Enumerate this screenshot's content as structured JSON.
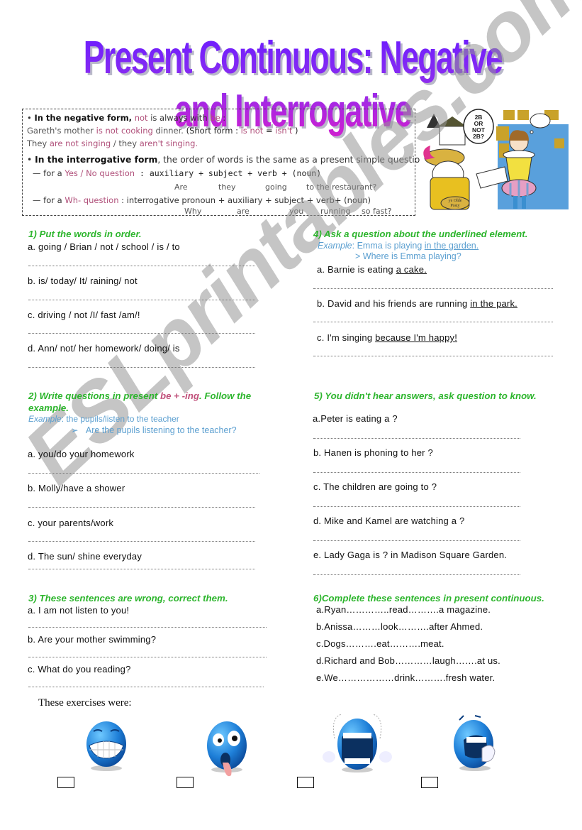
{
  "title": "Present Continuous: Negative and Interrogative",
  "grammar": {
    "negative_heading": "In the negative form,",
    "negative_rule_not": "not",
    "negative_rule_mid": " is always with ",
    "negative_rule_be": "be",
    "negative_rule_end": " :",
    "example1_a": "Gareth's mother ",
    "example1_b": "is not cooking",
    "example1_c": " dinner. ",
    "example1_d": "(Short form : ",
    "example1_e": "is not",
    "example1_f": " = ",
    "example1_g": "isn't",
    "example1_h": " )",
    "example2_a": "They ",
    "example2_b": "are not singing",
    "example2_c": " / they ",
    "example2_d": "aren't singing.",
    "interrogative_heading": "In the interrogative form",
    "interrogative_rule": ", the order of words is the same as a present simple question.",
    "yesno_prefix": "— for a ",
    "yesno_label": "Yes / No question",
    "yesno_formula": " : auxiliary + subject + verb + (noun)",
    "yesno_example": [
      "Are",
      "they",
      "going",
      "to the restaurant?"
    ],
    "wh_prefix": "— for a ",
    "wh_label": "Wh- question",
    "wh_formula": " : interrogative pronoun + auxiliary + subject + verb+  (noun)",
    "wh_example": [
      "Why",
      "are",
      "you",
      "running",
      "so fast?"
    ]
  },
  "illustration": {
    "speech_bubble": [
      "2B",
      "OR",
      "NOT",
      "2B?"
    ],
    "bag_label": [
      "ye Olde",
      "Posty"
    ]
  },
  "section1": {
    "title": "1) Put the words in order.",
    "items": [
      "a. going / Brian / not / school / is / to",
      "b. is/ today/ It/ raining/ not",
      "c. driving / not /I/ fast /am/!",
      "d. Ann/ not/ her homework/ doing/ is"
    ]
  },
  "section2": {
    "title_a": "2) Write questions in present ",
    "title_b": "be + -ing",
    "title_c": ". Follow the",
    "title_d": "example.",
    "example_label": "Example",
    "example_prompt": ": the pupils/listen to the teacher",
    "example_answer": "Are the pupils listening to the teacher?",
    "items": [
      "a. you/do your homework",
      "b. Molly/have a shower",
      "c. your parents/work",
      "d. The sun/ shine everyday"
    ]
  },
  "section3": {
    "title": "3) These sentences are wrong, correct them.",
    "items": [
      "a. I am not listen to you!",
      "b. Are your  mother swimming?",
      "c. What do you reading?"
    ]
  },
  "section4": {
    "title": "4) Ask a question about the underlined element.",
    "example_label": "Example",
    "example_a": ": Emma is playing ",
    "example_b": "in the garden.",
    "example_answer": "> Where is Emma playing?",
    "items": [
      {
        "plain": "a. Barnie is eating ",
        "underlined": "a cake."
      },
      {
        "plain": "b. David and his friends are running ",
        "underlined": "in the park."
      },
      {
        "plain": "c. I'm singing ",
        "underlined": "because I'm happy!"
      }
    ]
  },
  "section5": {
    "title": "5) You didn't hear answers, ask question to know.",
    "items": [
      "a.Peter is eating a ?",
      "b. Hanen is phoning to her ?",
      "c. The children are going to ?",
      "d. Mike and Kamel are watching a ?",
      "e. Lady Gaga is ? in Madison Square Garden."
    ]
  },
  "section6": {
    "title": "6)Complete these sentences in present continuous.",
    "items": [
      "a.Ryan…………..read……….a magazine.",
      "b.Anissa………look……….after Ahmed.",
      "c.Dogs……….eat……….meat.",
      "d.Richard and Bob…………laugh…….at us.",
      "e.We………………drink……….fresh water."
    ]
  },
  "watermark": "ESLprintables.com",
  "feedback": {
    "label": "These exercises were:",
    "options": [
      "grinning-smiley",
      "dizzy-smiley",
      "crying-smiley",
      "yawning-smiley"
    ]
  },
  "colors": {
    "section_title": "#2db52d",
    "highlight_pink": "#b0507a",
    "example_blue": "#5b9fd0",
    "title_purple": "#7a22f0",
    "title_magenta": "#d020d0",
    "smiley_blue": "#1e7fd8"
  }
}
